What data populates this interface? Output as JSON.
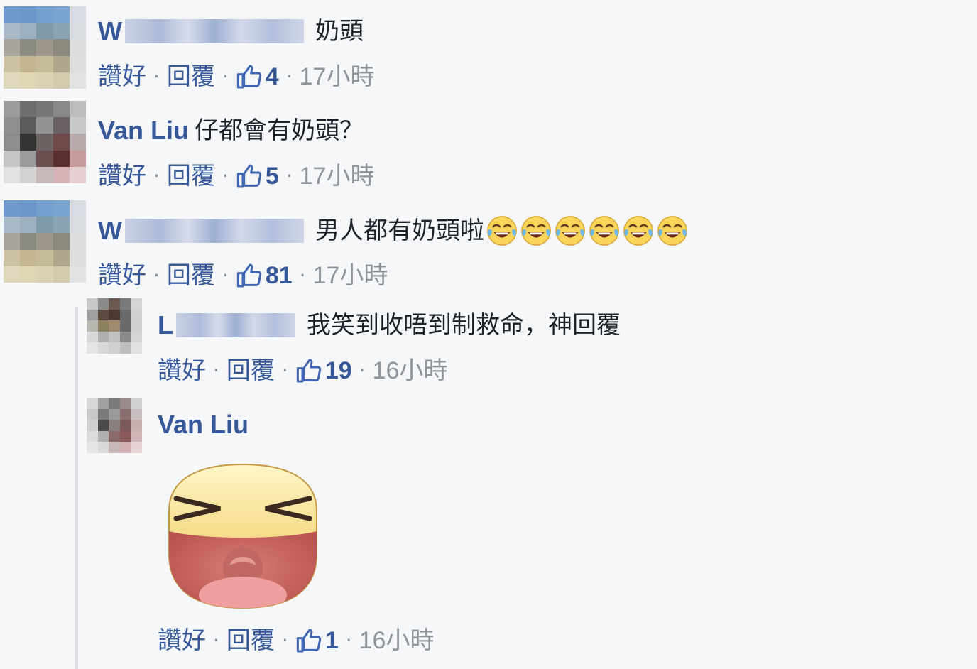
{
  "actions": {
    "like": "讚好",
    "reply": "回覆",
    "separator": "·"
  },
  "comments": [
    {
      "name_visible": "W",
      "text": "奶頭",
      "likes": "4",
      "time": "17小時",
      "emoji_count": 0
    },
    {
      "name_visible": "Van Liu",
      "text": "仔都會有奶頭？",
      "likes": "5",
      "time": "17小時",
      "emoji_count": 0
    },
    {
      "name_visible": "W",
      "text": "男人都有奶頭啦",
      "likes": "81",
      "time": "17小時",
      "emoji_count": 6
    }
  ],
  "replies": [
    {
      "name_visible": "L",
      "text": "我笑到收唔到制救命，神回覆",
      "likes": "19",
      "time": "16小時"
    },
    {
      "name_visible": "Van Liu",
      "text": "",
      "likes": "1",
      "time": "16小時",
      "sticker": "laughing-sticker"
    }
  ],
  "colors": {
    "name": "#365899",
    "meta": "#90949c",
    "background": "#f6f7f9",
    "text": "#1d2129"
  },
  "icons": {
    "like": "thumbs-up-icon",
    "emoji": "tears-of-joy-emoji"
  }
}
